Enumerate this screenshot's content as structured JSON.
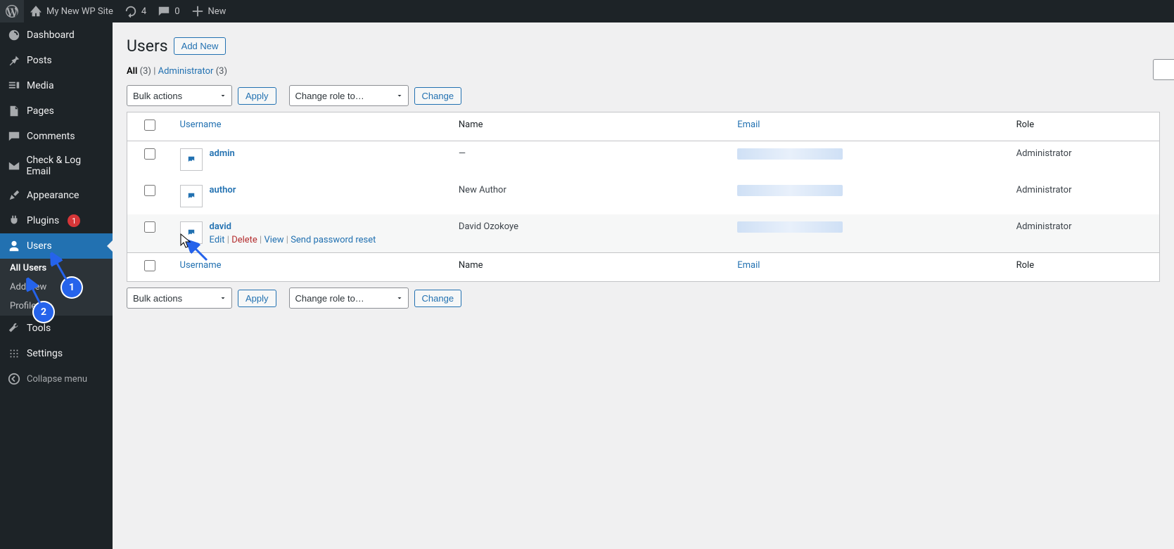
{
  "adminbar": {
    "site_name": "My New WP Site",
    "updates_count": "4",
    "comments_count": "0",
    "new_label": "New"
  },
  "sidebar": {
    "items": [
      {
        "label": "Dashboard"
      },
      {
        "label": "Posts"
      },
      {
        "label": "Media"
      },
      {
        "label": "Pages"
      },
      {
        "label": "Comments"
      },
      {
        "label": "Check & Log Email"
      },
      {
        "label": "Appearance"
      },
      {
        "label": "Plugins",
        "badge": "1"
      },
      {
        "label": "Users"
      },
      {
        "label": "Tools"
      },
      {
        "label": "Settings"
      }
    ],
    "users_submenu": [
      {
        "label": "All Users"
      },
      {
        "label": "Add New"
      },
      {
        "label": "Profile"
      }
    ],
    "collapse_label": "Collapse menu"
  },
  "page": {
    "title": "Users",
    "add_new": "Add New",
    "filters": {
      "all_label": "All",
      "all_count": "(3)",
      "admin_label": "Administrator",
      "admin_count": "(3)",
      "sep": " | "
    },
    "bulk_actions_label": "Bulk actions",
    "apply_label": "Apply",
    "change_role_label": "Change role to…",
    "change_label": "Change",
    "columns": {
      "username": "Username",
      "name": "Name",
      "email": "Email",
      "role": "Role"
    },
    "rows": [
      {
        "username": "admin",
        "name": "—",
        "role": "Administrator"
      },
      {
        "username": "author",
        "name": "New Author",
        "role": "Administrator"
      },
      {
        "username": "david",
        "name": "David Ozokoye",
        "role": "Administrator"
      }
    ],
    "row_actions": {
      "edit": "Edit",
      "delete": "Delete",
      "view": "View",
      "reset": "Send password reset",
      "sep": " | "
    }
  },
  "annotations": {
    "marker1": "1",
    "marker2": "2"
  }
}
